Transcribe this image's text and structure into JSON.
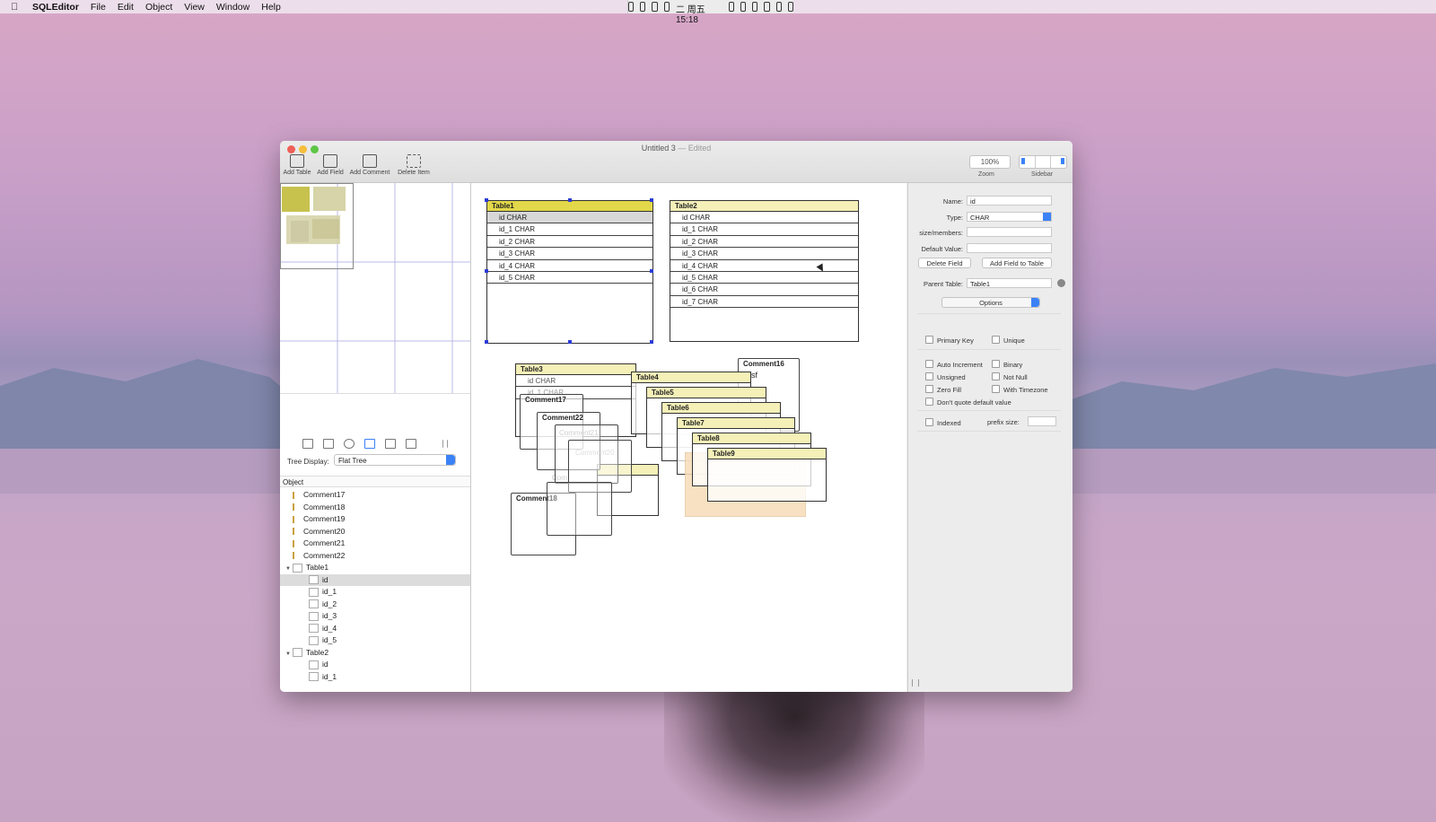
{
  "menubar": {
    "app": "SQLEditor",
    "items": [
      "File",
      "Edit",
      "Object",
      "View",
      "Window",
      "Help"
    ],
    "clock": "4月26日 廿二 周五 15:18"
  },
  "window": {
    "title": "Untitled 3",
    "status": "— Edited",
    "toolbar": {
      "add_table": "Add Table",
      "add_field": "Add Field",
      "add_comment": "Add Comment",
      "delete_item": "Delete Item"
    },
    "zoom_value": "100%",
    "zoom_label": "Zoom",
    "sidebar_label": "Sidebar"
  },
  "left": {
    "tree_display_label": "Tree Display:",
    "tree_display_value": "Flat Tree",
    "object_header": "Object",
    "tree": [
      {
        "label": "Comment17",
        "type": "comment",
        "level": 1
      },
      {
        "label": "Comment18",
        "type": "comment",
        "level": 1
      },
      {
        "label": "Comment19",
        "type": "comment",
        "level": 1
      },
      {
        "label": "Comment20",
        "type": "comment",
        "level": 1
      },
      {
        "label": "Comment21",
        "type": "comment",
        "level": 1
      },
      {
        "label": "Comment22",
        "type": "comment",
        "level": 1
      },
      {
        "label": "Table1",
        "type": "table",
        "level": 1,
        "open": true
      },
      {
        "label": "id",
        "type": "field",
        "level": 2,
        "selected": true
      },
      {
        "label": "id_1",
        "type": "field",
        "level": 2
      },
      {
        "label": "id_2",
        "type": "field",
        "level": 2
      },
      {
        "label": "id_3",
        "type": "field",
        "level": 2
      },
      {
        "label": "id_4",
        "type": "field",
        "level": 2
      },
      {
        "label": "id_5",
        "type": "field",
        "level": 2
      },
      {
        "label": "Table2",
        "type": "table",
        "level": 1,
        "open": true
      },
      {
        "label": "id",
        "type": "field",
        "level": 2
      },
      {
        "label": "id_1",
        "type": "field",
        "level": 2
      }
    ]
  },
  "canvas": {
    "table1": {
      "name": "Table1",
      "fields": [
        "id CHAR",
        "id_1 CHAR",
        "id_2 CHAR",
        "id_3 CHAR",
        "id_4 CHAR",
        "id_5 CHAR"
      ]
    },
    "table2": {
      "name": "Table2",
      "fields": [
        "id CHAR",
        "id_1 CHAR",
        "id_2 CHAR",
        "id_3 CHAR",
        "id_4 CHAR",
        "id_5 CHAR",
        "id_6 CHAR",
        "id_7 CHAR"
      ]
    },
    "table3": {
      "name": "Table3",
      "field0": "id CHAR",
      "field1": "id_1 CHAR"
    },
    "table4": "Table4",
    "table5": "Table5",
    "table6": "Table6",
    "table7": "Table7",
    "table8": "Table8",
    "table9": "Table9",
    "comment16": "Comment16",
    "comment16_text": "sf",
    "comment17": "Comment17",
    "comment22": "Comment22",
    "comment18": "Comment18",
    "ghost_comment21": "Comment21",
    "ghost_comment20": "Comment20",
    "ghost_com": "Com"
  },
  "inspector": {
    "name_label": "Name:",
    "name_value": "id",
    "type_label": "Type:",
    "type_value": "CHAR",
    "size_label": "size/members:",
    "default_label": "Default Value:",
    "delete_field": "Delete Field",
    "add_field_to_table": "Add Field to Table",
    "parent_label": "Parent Table:",
    "parent_value": "Table1",
    "options": "Options",
    "primary_key": "Primary Key",
    "unique": "Unique",
    "auto_increment": "Auto Increment",
    "binary": "Binary",
    "unsigned": "Unsigned",
    "not_null": "Not Null",
    "zero_fill": "Zero Fill",
    "with_timezone": "With Timezone",
    "dont_quote": "Don't quote default value",
    "indexed": "Indexed",
    "prefix_size": "prefix size:"
  },
  "colors": {
    "accent": "#3b82f7",
    "table_header": "#f5f0b8",
    "table_header_active": "#e2d84a",
    "selection_handle": "#2b3bd6"
  }
}
